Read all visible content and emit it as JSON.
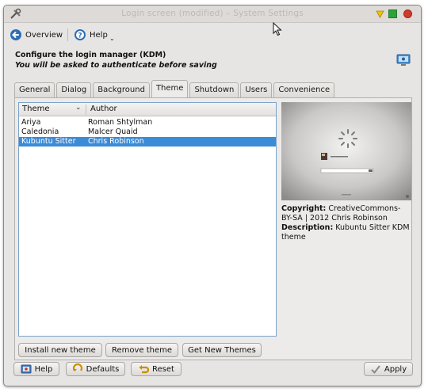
{
  "window": {
    "title": "Login screen (modified) – System Settings"
  },
  "toolbar": {
    "overview_label": "Overview",
    "help_label": "Help"
  },
  "header": {
    "title": "Configure the login manager (KDM)",
    "subtitle": "You will be asked to authenticate before saving"
  },
  "tabs": [
    {
      "label": "General",
      "active": false
    },
    {
      "label": "Dialog",
      "active": false
    },
    {
      "label": "Background",
      "active": false
    },
    {
      "label": "Theme",
      "active": true
    },
    {
      "label": "Shutdown",
      "active": false
    },
    {
      "label": "Users",
      "active": false
    },
    {
      "label": "Convenience",
      "active": false
    }
  ],
  "theme_list": {
    "columns": [
      "Theme",
      "Author"
    ],
    "rows": [
      {
        "theme": "Ariya",
        "author": "Roman Shtylman",
        "selected": false
      },
      {
        "theme": "Caledonia",
        "author": "Malcer Quaid",
        "selected": false
      },
      {
        "theme": "Kubuntu Sitter",
        "author": "Chris Robinson",
        "selected": true
      }
    ]
  },
  "details": {
    "copyright_label": "Copyright:",
    "copyright_value": "CreativeCommons-BY-SA | 2012 Chris Robinson",
    "description_label": "Description:",
    "description_value": "Kubuntu Sitter KDM theme"
  },
  "theme_buttons": {
    "install": "Install new theme",
    "remove": "Remove theme",
    "get_new": "Get New Themes"
  },
  "footer": {
    "help": "Help",
    "defaults": "Defaults",
    "reset": "Reset",
    "apply": "Apply"
  },
  "colors": {
    "selection": "#3c8bd6",
    "window_bg": "#e7e5e3",
    "list_border": "#7ba3c9"
  }
}
